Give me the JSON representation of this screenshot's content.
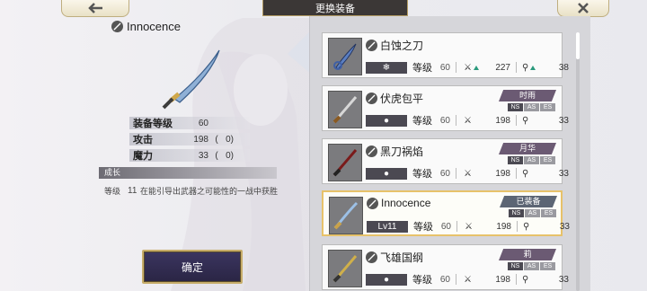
{
  "header": {
    "title": "更换装备"
  },
  "left": {
    "name": "Innocence",
    "stats": [
      {
        "label": "装备等级",
        "value": "60",
        "bonus": ""
      },
      {
        "label": "攻击",
        "value": "198",
        "bonus": "0"
      },
      {
        "label": "魔力",
        "value": "33",
        "bonus": "0"
      }
    ],
    "growth": {
      "title": "成长",
      "level_label": "等级",
      "level": "11",
      "text": "在能引导出武器之可能性的一战中获胜"
    },
    "confirm": "确定"
  },
  "list": {
    "level_label": "等级",
    "items": [
      {
        "name": "白蚀之刀",
        "lv": "",
        "level": "60",
        "atk": "227",
        "mag": "38",
        "badge": "",
        "modes": []
      },
      {
        "name": "伏虎包平",
        "lv": "",
        "level": "60",
        "atk": "198",
        "mag": "33",
        "badge": "时雨",
        "modes": [
          "NS",
          "AS",
          "ES"
        ]
      },
      {
        "name": "黑刀祸焰",
        "lv": "",
        "level": "60",
        "atk": "198",
        "mag": "33",
        "badge": "月华",
        "modes": [
          "NS",
          "AS",
          "ES"
        ]
      },
      {
        "name": "Innocence",
        "lv": "Lv11",
        "level": "60",
        "atk": "198",
        "mag": "33",
        "badge": "已装备",
        "modes": [
          "NS",
          "AS",
          "ES"
        ]
      },
      {
        "name": "飞雄国纲",
        "lv": "",
        "level": "60",
        "atk": "198",
        "mag": "33",
        "badge": "莉",
        "modes": [
          "NS",
          "AS",
          "ES"
        ]
      }
    ]
  },
  "colors": {
    "gold": "#c7ad6a",
    "selected": "#e7c26a",
    "badge": "#6b5a73",
    "up_arrow": "#2a9a7c"
  }
}
